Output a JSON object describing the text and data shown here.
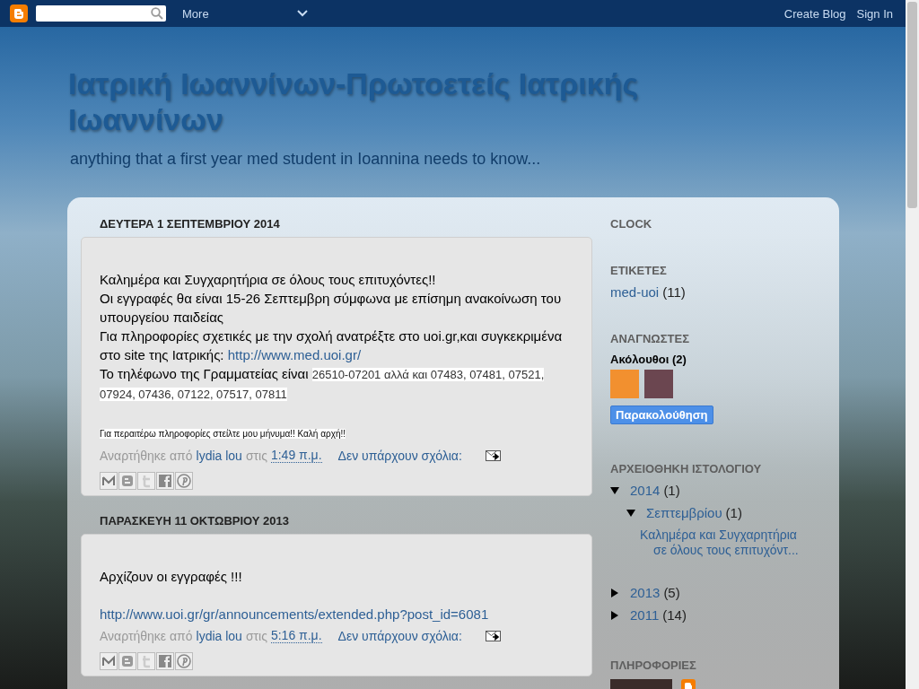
{
  "navbar": {
    "more": "More",
    "links": [
      "Create Blog",
      "Sign In"
    ]
  },
  "header": {
    "title": "Ιατρική Ιωαννίνων-Πρωτοετείς Ιατρικής Ιωαννίνων",
    "description": "anything that a first year med student in Ioannina needs to know..."
  },
  "posts": [
    {
      "date": "ΔΕΥΤΕΡΑ 1 ΣΕΠΤΕΜΒΡΙΟΥ 2014",
      "body": [
        {
          "kind": "text",
          "segments": [
            {
              "kind": "plain",
              "text": "Καλημέρα και Συγχαρητήρια σε όλους τους επιτυχόντες!!"
            }
          ]
        },
        {
          "kind": "text",
          "segments": [
            {
              "kind": "plain",
              "text": "Οι εγγραφές θα είναι 15-26 Σεπτεμβρη σύμφωνα με επίσημη ανακοίνωση του υπουργείου παιδείας"
            }
          ]
        },
        {
          "kind": "text",
          "segments": [
            {
              "kind": "plain",
              "text": "Για πληροφορίες σχετικές με την σχολή ανατρέξτε στο uoi.gr,και συγκεκριμένα στο site της Ιατρικής: "
            },
            {
              "kind": "link",
              "text": "http://www.med.uoi.gr/"
            }
          ]
        },
        {
          "kind": "text",
          "segments": [
            {
              "kind": "plain",
              "text": "Το τηλέφωνο της Γραμματείας είναι "
            },
            {
              "kind": "highlight",
              "text": "26510-07201 αλλά και 07483, 07481, 07521, 07924, 07436, 07122, 07517, 07811"
            }
          ]
        },
        {
          "kind": "blank"
        },
        {
          "kind": "text",
          "segments": [
            {
              "kind": "fine",
              "text": "Για περαιτέρω πληροφορίες στείλτε μου μήνυμα!! Καλή αρχή!!"
            }
          ]
        }
      ],
      "footer": {
        "posted_by": "Αναρτήθηκε από",
        "author": "lydia lou",
        "at": "στις",
        "time": "1:49 π.μ.",
        "comments": "Δεν υπάρχουν σχόλια:"
      }
    },
    {
      "date": "ΠΑΡΑΣΚΕΥΗ 11 ΟΚΤΩΒΡΙΟΥ 2013",
      "body": [
        {
          "kind": "text",
          "segments": [
            {
              "kind": "plain",
              "text": "Αρχίζουν οι εγγραφές !!!"
            }
          ]
        },
        {
          "kind": "blank"
        },
        {
          "kind": "text",
          "segments": [
            {
              "kind": "link",
              "text": "http://www.uoi.gr/gr/announcements/extended.php?post_id=6081"
            }
          ]
        }
      ],
      "footer": {
        "posted_by": "Αναρτήθηκε από",
        "author": "lydia lou",
        "at": "στις",
        "time": "5:16 π.μ.",
        "comments": "Δεν υπάρχουν σχόλια:"
      }
    }
  ],
  "sidebar": {
    "clock": {
      "title": "CLOCK"
    },
    "labels": {
      "title": "ΕΤΙΚΕΤΕΣ",
      "items": [
        {
          "label": "med-uoi",
          "count": "(11)"
        }
      ]
    },
    "followers": {
      "title": "ΑΝΑΓΝΩΣΤΕΣ",
      "label": "Ακόλουθοι (2)",
      "avatars": [
        {
          "kind": "cartoon"
        },
        {
          "kind": "photo"
        }
      ],
      "button": "Παρακολούθηση"
    },
    "archive": {
      "title": "ΑΡΧΕΙΟΘΗΚΗ ΙΣΤΟΛΟΓΙΟΥ",
      "items": [
        {
          "label": "2014",
          "count": "(1)",
          "expanded": true,
          "children": [
            {
              "label": "Σεπτεμβρίου",
              "count": "(1)",
              "expanded": true,
              "posts": [
                "Καλημέρα και Συγχαρητήρια σε όλους τους επιτυχόντ..."
              ]
            }
          ]
        },
        {
          "label": "2013",
          "count": "(5)",
          "expanded": false
        },
        {
          "label": "2011",
          "count": "(14)",
          "expanded": false
        }
      ]
    },
    "profile": {
      "title": "ΠΛΗΡΟΦΟΡΙΕΣ"
    }
  }
}
